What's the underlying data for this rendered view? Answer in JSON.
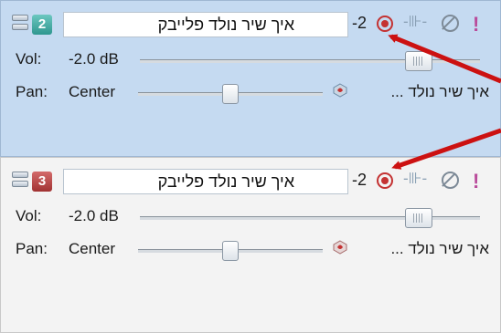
{
  "tracks": [
    {
      "number": "2",
      "name": "איך שיר נולד פלייבק",
      "db_readout": "-2",
      "vol_label": "Vol:",
      "vol_value": "-2.0 dB",
      "vol_level": 0.82,
      "pan_label": "Pan:",
      "pan_value": "Center",
      "pan_level": 0.5,
      "bus_name": "איך שיר נולד ...",
      "selected": true
    },
    {
      "number": "3",
      "name": "איך שיר נולד פלייבק",
      "db_readout": "-2",
      "vol_label": "Vol:",
      "vol_value": "-2.0 dB",
      "vol_level": 0.82,
      "pan_label": "Pan:",
      "pan_value": "Center",
      "pan_level": 0.5,
      "bus_name": "איך שיר נולד ...",
      "selected": false
    }
  ],
  "icons": {
    "arm": "record-arm-icon",
    "fx": "fx-plugin-icon",
    "mute": "mute-icon",
    "solo": "solo-icon",
    "bus": "bus-output-icon"
  },
  "colors": {
    "selected_bg": "#c5daf1",
    "unselected_bg": "#f3f3f3",
    "arrow": "#cc1111",
    "arm": "#c43232"
  }
}
